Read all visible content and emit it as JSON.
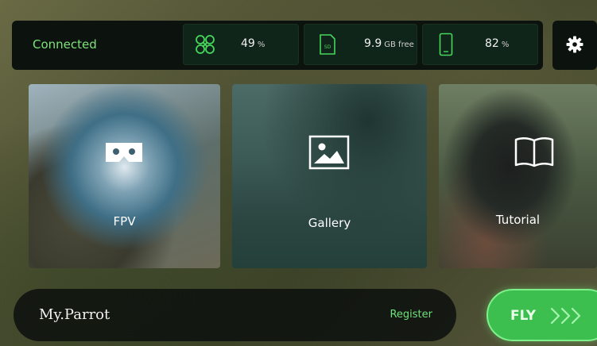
{
  "status_bar": {
    "connection": "Connected",
    "drone_battery": {
      "value": "49",
      "unit": "%",
      "icon": "drone-icon"
    },
    "storage": {
      "value": "9.9",
      "unit": "GB free",
      "icon": "sd-card-icon",
      "card_label": "SD"
    },
    "phone_battery": {
      "value": "82",
      "unit": "%",
      "icon": "phone-icon"
    },
    "settings_icon": "gear-icon"
  },
  "tiles": [
    {
      "label": "FPV",
      "icon": "vr-headset-icon"
    },
    {
      "label": "Gallery",
      "icon": "image-icon"
    },
    {
      "label": "Tutorial",
      "icon": "book-icon"
    }
  ],
  "my_parrot": {
    "logo": "My.Parrot",
    "register": "Register"
  },
  "fly": {
    "label": "FLY",
    "icon": "chevrons-right-icon"
  },
  "colors": {
    "accent_green": "#6fe07b",
    "fly_button": "#3dbf4f",
    "panel_bg": "#0c130f"
  }
}
